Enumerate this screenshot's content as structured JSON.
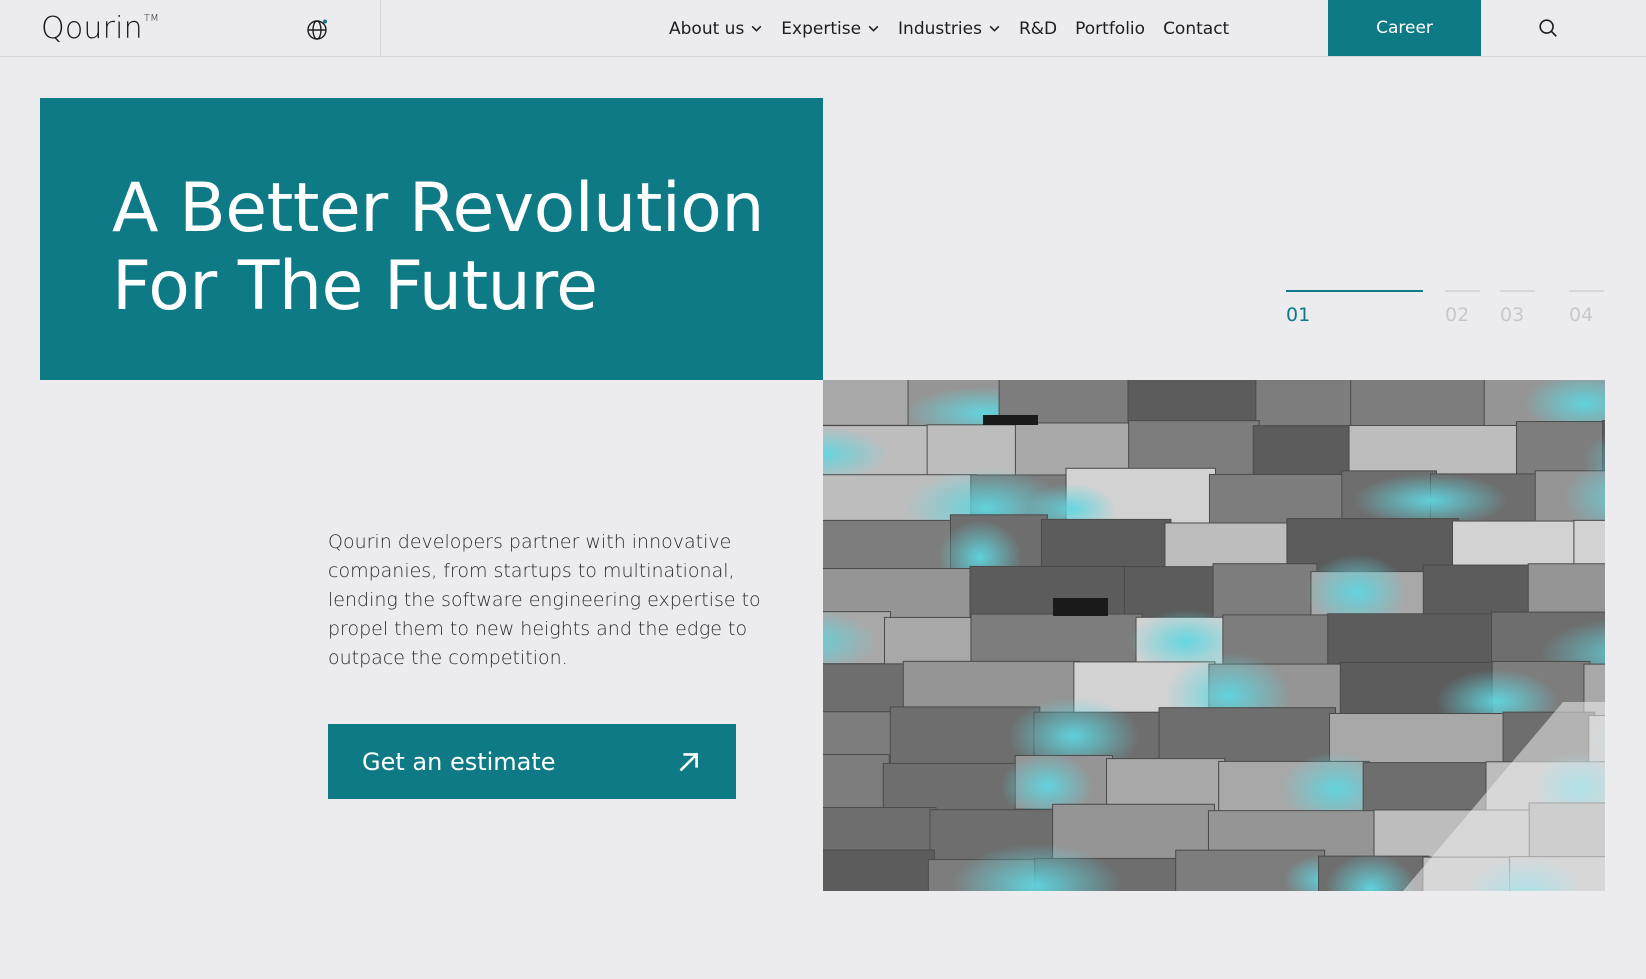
{
  "header": {
    "logo": "Qourin",
    "trademark": "TM",
    "nav": [
      {
        "label": "About us",
        "dropdown": true
      },
      {
        "label": "Expertise",
        "dropdown": true
      },
      {
        "label": "Industries",
        "dropdown": true
      },
      {
        "label": "R&D",
        "dropdown": false
      },
      {
        "label": "Portfolio",
        "dropdown": false
      },
      {
        "label": "Contact",
        "dropdown": false
      }
    ],
    "career_label": "Career",
    "icons": {
      "language": "globe-icon",
      "search": "search-icon"
    }
  },
  "hero": {
    "title_line1": "A Better Revolution",
    "title_line2": "For The Future",
    "slides": [
      "01",
      "02",
      "03",
      "04"
    ],
    "active_slide": 0,
    "description": "Qourin developers partner with innovative companies, from startups to multinational, lending the software engineering expertise to propel them to new heights and the edge to outpace the competition.",
    "cta_label": "Get an estimate",
    "cta_icon": "arrow-up-right-icon"
  },
  "colors": {
    "accent": "#0d7a85",
    "background": "#ececee",
    "text": "#1d1d1f"
  }
}
